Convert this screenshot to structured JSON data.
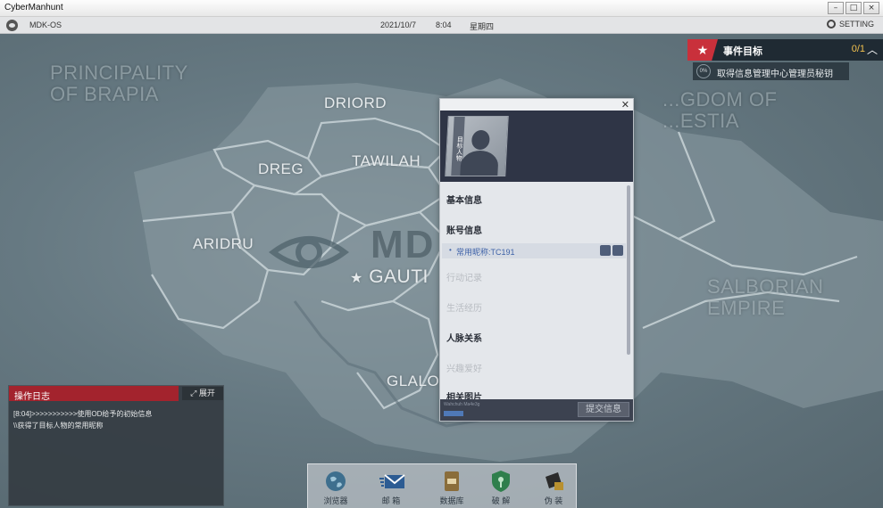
{
  "window": {
    "title": "CyberManhunt",
    "buttons": [
      "–",
      "□",
      "×"
    ]
  },
  "os_bar": {
    "name": "MDK-OS",
    "date": "2021/10/7",
    "time": "8:04",
    "weekday": "星期四",
    "setting_label": "SETTING"
  },
  "map": {
    "regions": {
      "brapia": "PRINCIPALITY\nOF BRAPIA",
      "driord": "DRIORD",
      "dreg": "DREG",
      "tawilah": "TAWILAH",
      "aridru": "ARIDRU",
      "gautier": "GAUTI",
      "glalo": "GLALO",
      "kingdom": "...GDOM OF\n...ESTIA",
      "salborian": "SALBORIAN\nEMPIRE"
    },
    "watermark": "MD"
  },
  "objective": {
    "title": "事件目标",
    "count": "0/1",
    "item_pct": "0%",
    "item_text": "取得信息管理中心管理员秘钥"
  },
  "profile": {
    "photo_tag": "目标人物",
    "sections": {
      "basic": "基本信息",
      "account": "账号信息",
      "record": "行动记录",
      "life": "生活经历",
      "relations": "人脉关系",
      "hobbies": "兴趣爱好",
      "photos": "相关图片"
    },
    "account_row": "常用昵称:TC191",
    "footer_tiny": "Wahchuh  Ma4e3g",
    "submit_label": "提交信息"
  },
  "log": {
    "title": "操作日志",
    "expand_label": "展开",
    "lines": [
      "[8:04]>>>>>>>>>>>使用OD给予的初始信息",
      "\\\\获得了目标人物的常用昵称"
    ]
  },
  "dock": {
    "items": [
      {
        "label": "浏览器",
        "icon": "globe-icon"
      },
      {
        "label": "邮 箱",
        "icon": "mail-icon"
      },
      {
        "label": "数据库",
        "icon": "database-icon"
      },
      {
        "label": "破 解",
        "icon": "shield-key-icon"
      },
      {
        "label": "伪 装",
        "icon": "disguise-icon"
      }
    ]
  }
}
